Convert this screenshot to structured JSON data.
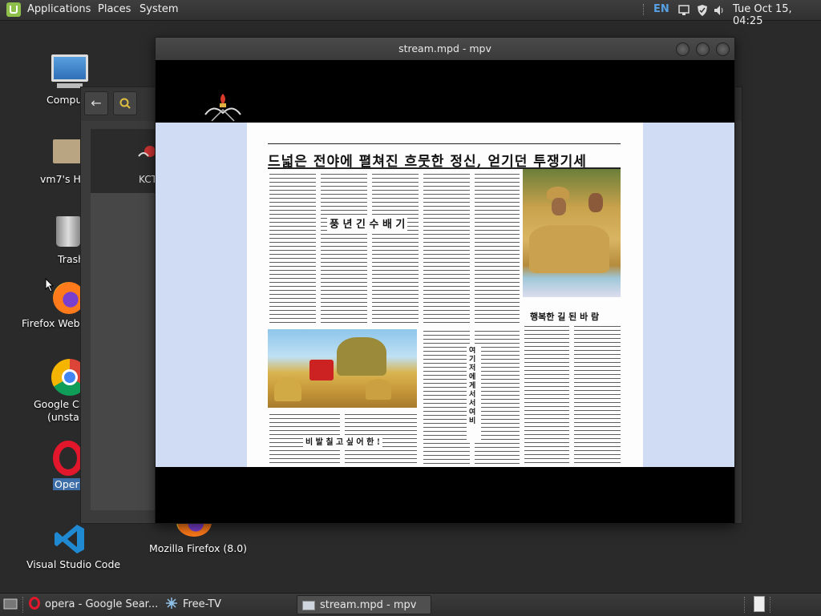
{
  "top_panel": {
    "menu": [
      "Applications",
      "Places",
      "System"
    ],
    "keyboard_layout": "EN",
    "clock": "Tue Oct 15, 04:25"
  },
  "desktop_icons": [
    {
      "label": "Compu",
      "icon": "computer-icon"
    },
    {
      "label": "vm7's H",
      "icon": "home-folder-icon"
    },
    {
      "label": "Trash",
      "icon": "trash-icon"
    },
    {
      "label": "Firefox Web",
      "icon": "firefox-icon"
    },
    {
      "label": "Google Ch",
      "label2": "(unsta",
      "icon": "chrome-icon"
    },
    {
      "label": "Oper",
      "icon": "opera-icon"
    },
    {
      "label": "Visual Studio Code",
      "icon": "vscode-icon"
    },
    {
      "label": "Mozilla Firefox (8.0)",
      "icon": "firefox-old-icon"
    }
  ],
  "file_manager": {
    "item_label": "KCT"
  },
  "mpv": {
    "title": "stream.mpd - mpv",
    "newspaper": {
      "headline": "드넓은 전야에 펼쳐진 흐뭇한 정신, 얻기던 투쟁기세",
      "subheading1": "풍 년 긴  수 배 기",
      "subheading2": "행복한  길 된 바 람",
      "subheading3": "비 발 칠 고  싶 어 한 !",
      "vertical_heading": "여 기 저 에 게 서 서 여 비"
    }
  },
  "taskbar": {
    "items": [
      {
        "label": "opera - Google Sear...",
        "icon": "opera-icon"
      },
      {
        "label": "Free-TV",
        "icon": "free-tv-icon"
      },
      {
        "label": "stream.mpd - mpv",
        "icon": "mpv-icon",
        "active": true
      }
    ]
  },
  "colors": {
    "panel_bg": "#303030",
    "accent_blue": "#57a0e3",
    "mint_green": "#8fbf4b",
    "paper_band": "#cfdcf3"
  }
}
